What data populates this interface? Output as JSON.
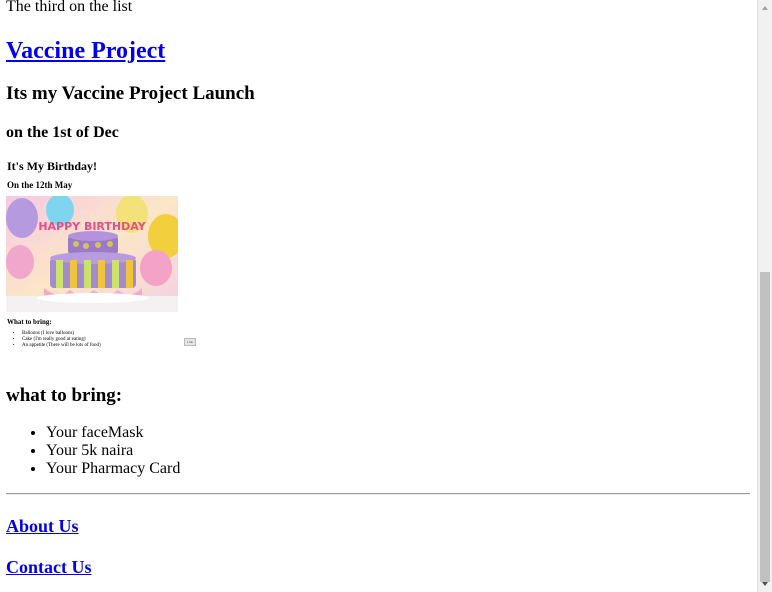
{
  "intro": "The third on the list",
  "project": {
    "title": "Vaccine Project",
    "launch": "Its my Vaccine Project Launch",
    "date": "on the 1st of Dec"
  },
  "embedded_page": {
    "title": "It's My Birthday!",
    "date": "On the 12th May",
    "image_caption": "HAPPY BIRTHDAY",
    "bring_title": "What to bring:",
    "items": [
      "Balloons (I love balloons)",
      "Cake (I'm really good at eating)",
      "An appetite (There will be lots of food)"
    ],
    "button_label": "Link"
  },
  "bring": {
    "title": "what to bring:",
    "items": [
      "Your faceMask",
      "Your 5k naira",
      "Your Pharmacy Card"
    ]
  },
  "nav": {
    "about": "About Us",
    "contact": "Contact Us"
  },
  "colors": {
    "link": "#0000ee",
    "scrollbar_track": "#f1f1f1",
    "scrollbar_thumb": "#c1c1c1"
  }
}
